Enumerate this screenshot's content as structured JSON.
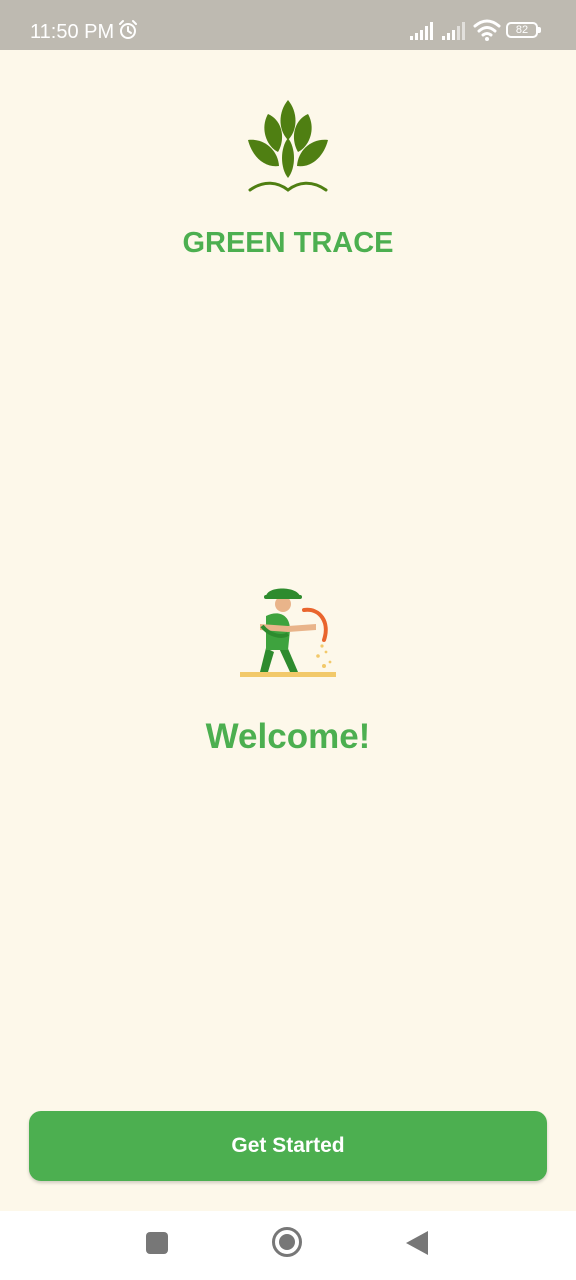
{
  "status_bar": {
    "time": "11:50 PM",
    "battery_level": "82",
    "icons": [
      "alarm-icon",
      "signal-icon",
      "signal-icon",
      "wifi-icon",
      "battery-icon"
    ]
  },
  "app": {
    "logo_icon": "wheat-leaves-logo-icon",
    "name": "GREEN TRACE",
    "illustration_icon": "farmer-harvesting-illustration"
  },
  "welcome": {
    "heading": "Welcome!"
  },
  "actions": {
    "get_started_label": "Get Started"
  },
  "navigation": {
    "icons": [
      "recents-square-icon",
      "home-circle-icon",
      "back-triangle-icon"
    ]
  },
  "colors": {
    "background": "#FDF8EA",
    "brand_green": "#4CAF50",
    "logo_green": "#4F7F12",
    "status_bar": "#BEBAB1"
  }
}
